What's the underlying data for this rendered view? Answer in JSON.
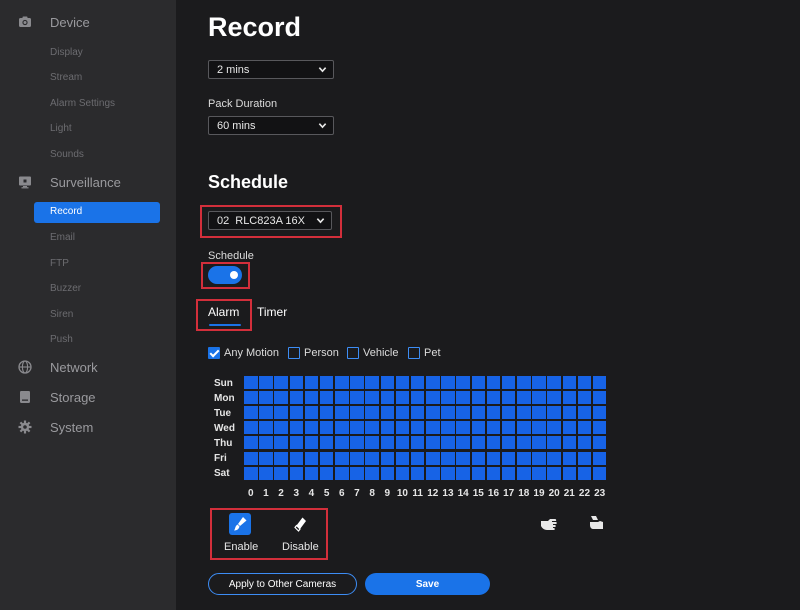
{
  "sidebar": {
    "categories": {
      "device": {
        "label": "Device",
        "icon": "camera-icon"
      },
      "surveillance": {
        "label": "Surveillance",
        "icon": "monitor-icon"
      },
      "network": {
        "label": "Network",
        "icon": "globe-icon"
      },
      "storage": {
        "label": "Storage",
        "icon": "hard-drive-icon"
      },
      "system": {
        "label": "System",
        "icon": "gear-icon"
      }
    },
    "device_items": [
      "Display",
      "Stream",
      "Alarm Settings",
      "Light",
      "Sounds"
    ],
    "surveillance_items": [
      "Record",
      "Email",
      "FTP",
      "Buzzer",
      "Siren",
      "Push"
    ],
    "active_item": "Record"
  },
  "main": {
    "title": "Record",
    "post_record_value": "2 mins",
    "pack_duration_label": "Pack Duration",
    "pack_duration_value": "60 mins",
    "schedule_heading": "Schedule",
    "camera_channel": "02",
    "camera_name": "RLC823A 16X",
    "schedule_toggle_label": "Schedule",
    "schedule_enabled": true,
    "tabs": [
      "Alarm",
      "Timer"
    ],
    "active_tab": "Alarm",
    "filters": [
      {
        "label": "Any Motion",
        "checked": true
      },
      {
        "label": "Person",
        "checked": false
      },
      {
        "label": "Vehicle",
        "checked": false
      },
      {
        "label": "Pet",
        "checked": false
      }
    ],
    "days": [
      "Sun",
      "Mon",
      "Tue",
      "Wed",
      "Thu",
      "Fri",
      "Sat"
    ],
    "hours": [
      "0",
      "1",
      "2",
      "3",
      "4",
      "5",
      "6",
      "7",
      "8",
      "9",
      "10",
      "11",
      "12",
      "13",
      "14",
      "15",
      "16",
      "17",
      "18",
      "19",
      "20",
      "21",
      "22",
      "23"
    ],
    "tools": {
      "enable_label": "Enable",
      "disable_label": "Disable"
    },
    "apply_button": "Apply to Other Cameras",
    "save_button": "Save"
  },
  "colors": {
    "accent": "#1a73e8",
    "grid_cell": "#1763e6",
    "highlight_box": "#d32f3b",
    "sidebar_bg": "#2b2b2d",
    "page_bg": "#1b1b1d"
  }
}
